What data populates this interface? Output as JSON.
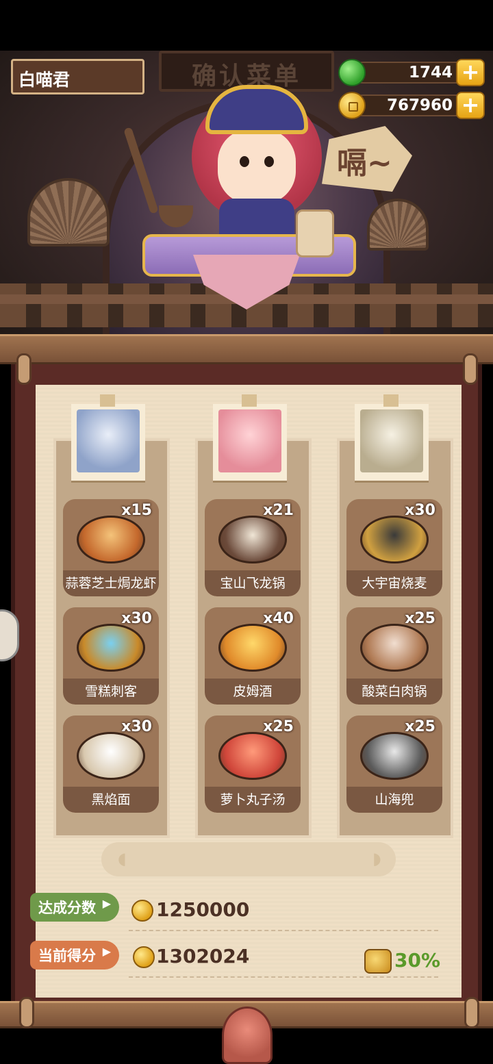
{
  "player": {
    "name": "白喵君"
  },
  "resources": {
    "gems": "1744",
    "coins": "767960"
  },
  "sign": {
    "title": "确认菜单"
  },
  "speech": {
    "text": "嗝~"
  },
  "columns": [
    {
      "customer_icon": "silver-hair-customer-avatar",
      "dishes": [
        {
          "count": "x15",
          "name": "蒜蓉芝士焗龙虾",
          "icon": "lobster-dish-icon"
        },
        {
          "count": "x30",
          "name": "雪糕刺客",
          "icon": "ice-cream-dish-icon"
        },
        {
          "count": "x30",
          "name": "黑焰面",
          "icon": "black-noodle-dish-icon"
        }
      ]
    },
    {
      "customer_icon": "bunny-hood-customer-avatar",
      "dishes": [
        {
          "count": "x21",
          "name": "宝山飞龙锅",
          "icon": "hotpot-dish-icon"
        },
        {
          "count": "x40",
          "name": "皮姆酒",
          "icon": "drink-dish-icon"
        },
        {
          "count": "x25",
          "name": "萝卜丸子汤",
          "icon": "soup-dish-icon"
        }
      ]
    },
    {
      "customer_icon": "white-hair-customer-avatar",
      "dishes": [
        {
          "count": "x30",
          "name": "大宇宙烧麦",
          "icon": "shaomai-dish-icon"
        },
        {
          "count": "x25",
          "name": "酸菜白肉锅",
          "icon": "pickled-pot-dish-icon"
        },
        {
          "count": "x25",
          "name": "山海兜",
          "icon": "dumpling-dish-icon"
        }
      ]
    }
  ],
  "score": {
    "target_label": "达成分数",
    "target_value": "1250000",
    "current_label": "当前得分",
    "current_value": "1302024",
    "bonus": "30%"
  },
  "colors": {
    "target_tag": "#6f9a4a",
    "current_tag": "#d97a4a",
    "bonus_text": "#5a9a2a"
  }
}
